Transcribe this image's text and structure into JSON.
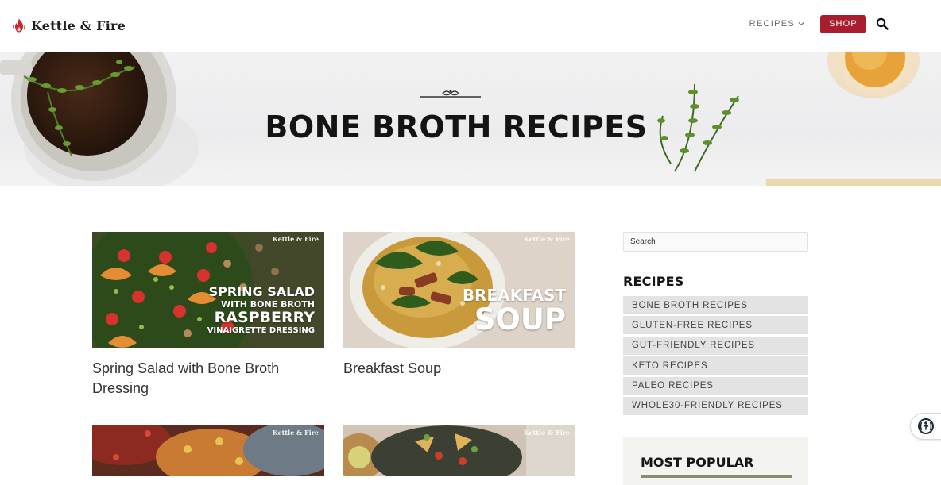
{
  "header": {
    "brand": "Kettle & Fire",
    "nav_recipes": "RECIPES",
    "shop": "SHOP"
  },
  "hero": {
    "title": "BONE BROTH RECIPES"
  },
  "cards": [
    {
      "title": "Spring Salad with Bone Broth Dressing",
      "watermark": "Kettle & Fire",
      "overlay": [
        "SPRING SALAD",
        "WITH BONE BROTH",
        "RASPBERRY",
        "VINAIGRETTE DRESSING"
      ]
    },
    {
      "title": "Breakfast Soup",
      "watermark": "Kettle & Fire",
      "overlay": [
        "BREAKFAST",
        "SOUP"
      ]
    },
    {
      "title": "",
      "watermark": "Kettle & Fire"
    },
    {
      "title": "",
      "watermark": "Kettle & Fire"
    }
  ],
  "sidebar": {
    "search_placeholder": "Search",
    "heading": "RECIPES",
    "items": [
      "BONE BROTH RECIPES",
      "GLUTEN-FREE RECIPES",
      "GUT-FRIENDLY RECIPES",
      "KETO RECIPES",
      "PALEO RECIPES",
      "WHOLE30-FRIENDLY RECIPES"
    ],
    "most_popular": "MOST POPULAR"
  },
  "colors": {
    "brand_red": "#a81e2e",
    "sidebar_item_bg": "#e3e3e4"
  },
  "icons": {
    "logo": "flame-icon",
    "search": "search-icon",
    "nav_caret": "chevron-down-icon",
    "accessibility": "accessibility-icon"
  }
}
